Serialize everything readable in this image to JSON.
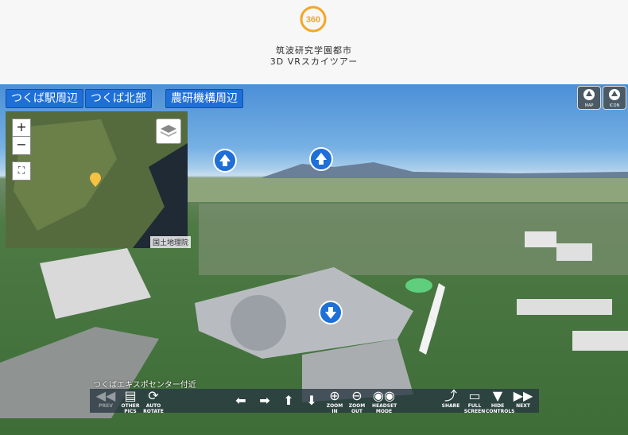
{
  "header": {
    "logo_text": "360",
    "title_line1": "筑波研究学園都市",
    "title_line2": "3D VRスカイツアー"
  },
  "areas": [
    "つくば駅周辺",
    "つくば北部",
    "農研機構周辺"
  ],
  "map": {
    "zoom_in": "+",
    "zoom_out": "−",
    "fullscreen": "⛶",
    "attribution": "国土地理院"
  },
  "corner_buttons": {
    "map": "MAP",
    "icon": "ICON"
  },
  "location_label": "つくばエキスポセンター付近",
  "toolbar": {
    "prev": "PREV",
    "other_pics": "OTHER PICS",
    "auto_rotate": "AUTO ROTATE",
    "zoom_in": "ZOOM IN",
    "zoom_out": "ZOOM OUT",
    "headset": "HEADSET MODE",
    "share": "SHARE",
    "full_screen": "FULL SCREEN",
    "hide_controls": "HIDE CONTROLS",
    "next": "NEXT"
  },
  "colors": {
    "accent": "#1e6fd8",
    "logo": "#f5a623"
  }
}
